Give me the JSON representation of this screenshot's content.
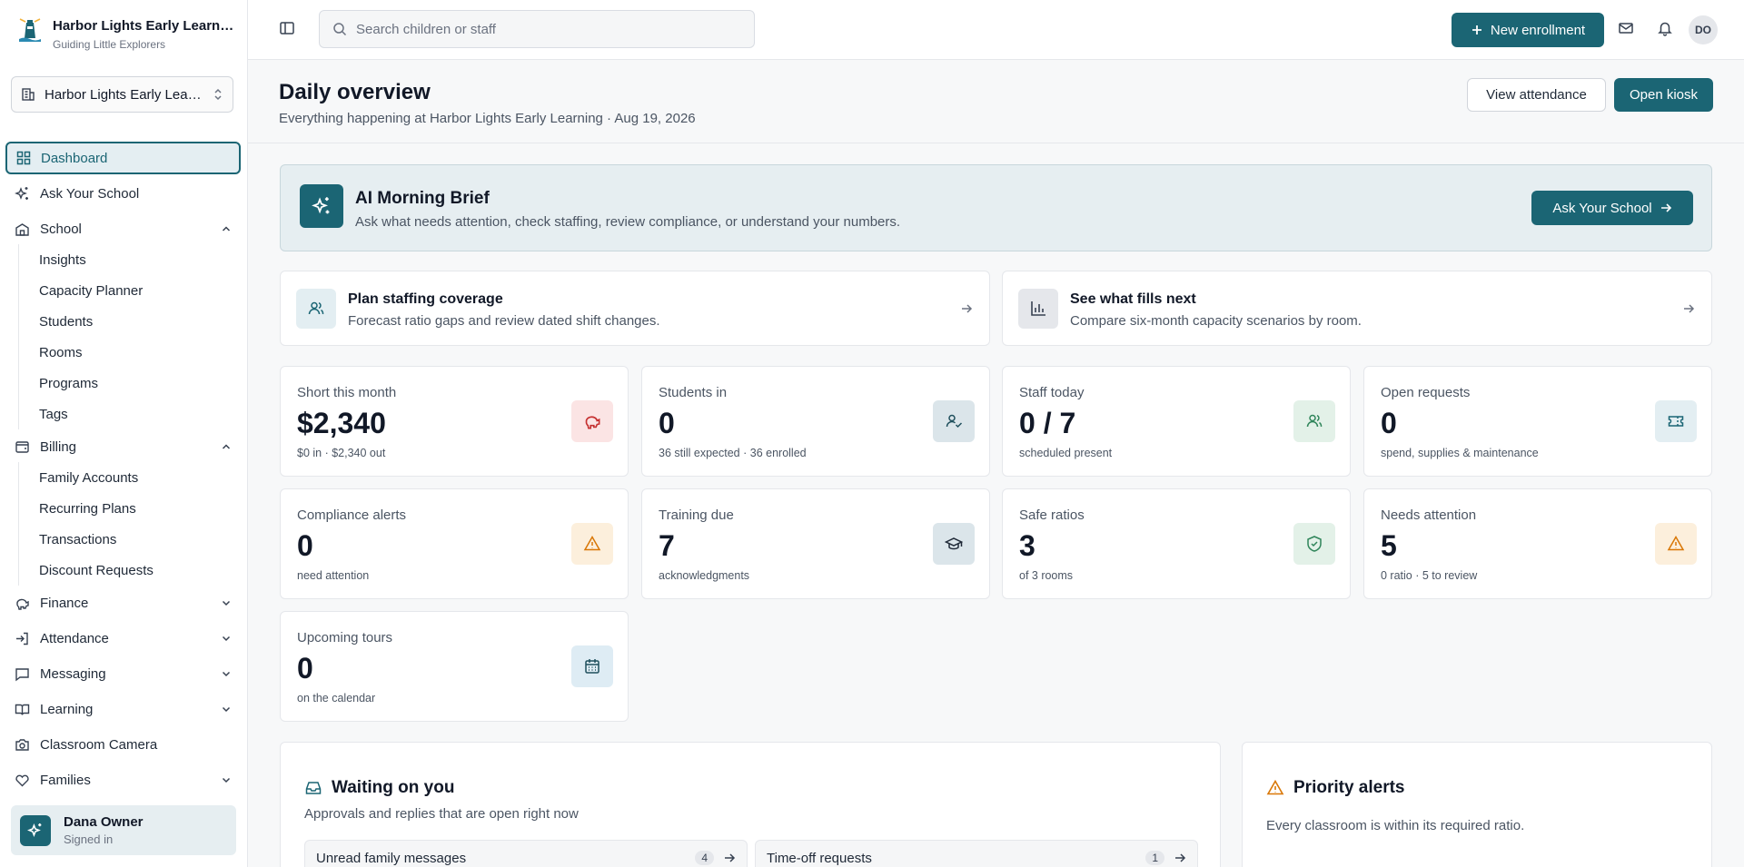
{
  "brand": {
    "name": "Harbor Lights Early Learning",
    "tagline": "Guiding Little Explorers"
  },
  "school_selector": {
    "value": "Harbor Lights Early Learning"
  },
  "nav": {
    "dashboard": "Dashboard",
    "ask": "Ask Your School",
    "school": "School",
    "school_items": [
      "Insights",
      "Capacity Planner",
      "Students",
      "Rooms",
      "Programs",
      "Tags"
    ],
    "billing": "Billing",
    "billing_items": [
      "Family Accounts",
      "Recurring Plans",
      "Transactions",
      "Discount Requests"
    ],
    "finance": "Finance",
    "attendance": "Attendance",
    "messaging": "Messaging",
    "learning": "Learning",
    "camera": "Classroom Camera",
    "families": "Families"
  },
  "user": {
    "name": "Dana Owner",
    "status": "Signed in",
    "initials": "DO"
  },
  "topbar": {
    "search_placeholder": "Search children or staff",
    "new_enrollment": "New enrollment"
  },
  "header": {
    "title": "Daily overview",
    "subtitle": "Everything happening at Harbor Lights Early Learning · Aug 19, 2026",
    "view_attendance": "View attendance",
    "open_kiosk": "Open kiosk"
  },
  "brief": {
    "title": "AI Morning Brief",
    "description": "Ask what needs attention, check staffing, review compliance, or understand your numbers.",
    "button": "Ask Your School"
  },
  "quick_links": [
    {
      "title": "Plan staffing coverage",
      "description": "Forecast ratio gaps and review dated shift changes."
    },
    {
      "title": "See what fills next",
      "description": "Compare six-month capacity scenarios by room."
    }
  ],
  "stats": [
    {
      "label": "Short this month",
      "value": "$2,340",
      "sub": "$0 in · $2,340 out",
      "icon": "piggy-bank-icon"
    },
    {
      "label": "Students in",
      "value": "0",
      "sub": "36 still expected · 36 enrolled",
      "icon": "user-check-icon"
    },
    {
      "label": "Staff today",
      "value": "0 / 7",
      "sub": "scheduled present",
      "icon": "users-icon"
    },
    {
      "label": "Open requests",
      "value": "0",
      "sub": "spend, supplies & maintenance",
      "icon": "ticket-icon"
    },
    {
      "label": "Compliance alerts",
      "value": "0",
      "sub": "need attention",
      "icon": "warning-icon"
    },
    {
      "label": "Training due",
      "value": "7",
      "sub": "acknowledgments",
      "icon": "graduation-cap-icon"
    },
    {
      "label": "Safe ratios",
      "value": "3",
      "sub": "of 3 rooms",
      "icon": "shield-check-icon"
    },
    {
      "label": "Needs attention",
      "value": "5",
      "sub": "0 ratio · 5 to review",
      "icon": "warning-icon"
    },
    {
      "label": "Upcoming tours",
      "value": "0",
      "sub": "on the calendar",
      "icon": "calendar-icon"
    }
  ],
  "waiting": {
    "title": "Waiting on you",
    "description": "Approvals and replies that are open right now",
    "items": [
      {
        "label": "Unread family messages",
        "count": "4"
      },
      {
        "label": "Time-off requests",
        "count": "1"
      }
    ]
  },
  "priority": {
    "title": "Priority alerts",
    "message": "Every classroom is within its required ratio."
  },
  "colors": {
    "primary": "#1b6574",
    "brief_bg": "#e6eef1",
    "alert_orange": "#d97706",
    "success_green": "#2f855a",
    "danger_red": "#c53030"
  }
}
